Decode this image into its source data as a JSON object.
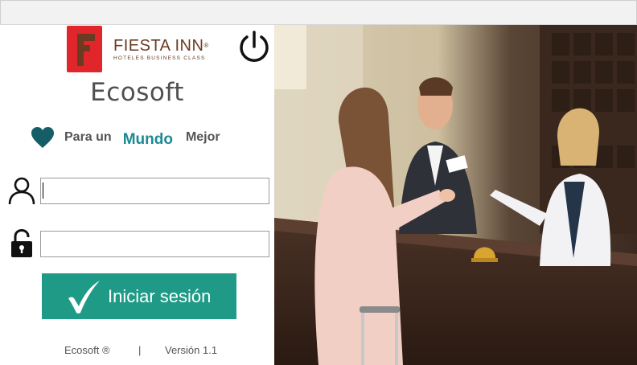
{
  "window": {
    "title": ""
  },
  "logo": {
    "name": "FIESTA INN",
    "registered": "®",
    "tagline": "HOTELES BUSINESS CLASS",
    "mark_color": "#e0262b",
    "accent_color": "#6a3b22"
  },
  "header": {
    "power_icon": "power-icon"
  },
  "app": {
    "title": "Ecosoft"
  },
  "slogan": {
    "icon": "heart-icon",
    "part1": "Para un",
    "part2": "Mundo",
    "part3": "Mejor",
    "heart_color": "#155e68",
    "highlight_color": "#1a8a94"
  },
  "form": {
    "user_icon": "user-icon",
    "user_value": "",
    "lock_icon": "unlock-icon",
    "password_value": ""
  },
  "login": {
    "label": "Iniciar sesión",
    "icon": "checkmark-icon",
    "color": "#1f9a86"
  },
  "footer": {
    "brand": "Ecosoft ®",
    "separator": "|",
    "version": "Versión 1.1"
  },
  "photo": {
    "subject": "hotel-reception-photo"
  }
}
